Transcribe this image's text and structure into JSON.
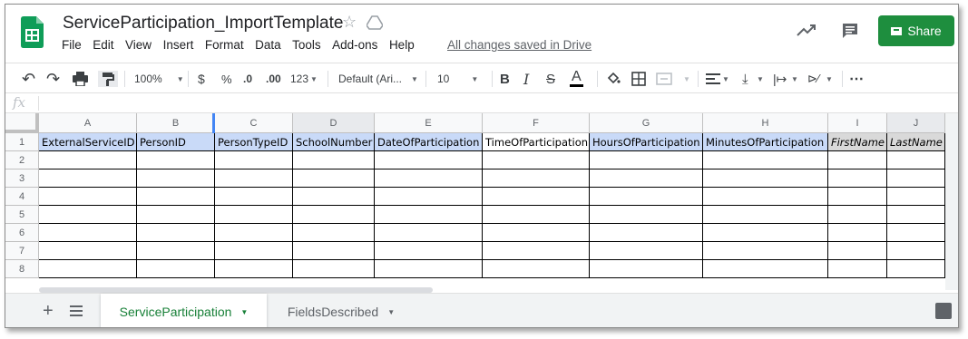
{
  "doc": {
    "title": "ServiceParticipation_ImportTemplate",
    "saved_status": "All changes saved in Drive"
  },
  "menu": [
    "File",
    "Edit",
    "View",
    "Insert",
    "Format",
    "Data",
    "Tools",
    "Add-ons",
    "Help"
  ],
  "share_label": "Share",
  "toolbar": {
    "zoom": "100%",
    "currency": "$",
    "percent": "%",
    "decrease_decimal": ".0",
    "increase_decimal": ".00",
    "more_formats": "123",
    "font": "Default (Ari...",
    "font_size": "10",
    "bold": "B",
    "italic": "I",
    "strike": "S",
    "text_color": "A",
    "more": "⋯"
  },
  "formula_bar": {
    "fx": "fx",
    "value": ""
  },
  "columns": [
    "A",
    "B",
    "C",
    "D",
    "E",
    "F",
    "G",
    "H",
    "I",
    "J"
  ],
  "rows": [
    "1",
    "2",
    "3",
    "4",
    "5",
    "6",
    "7",
    "8"
  ],
  "header_row": [
    "ExternalServiceID",
    "PersonID",
    "PersonTypeID",
    "SchoolNumber",
    "DateOfParticipation",
    "TimeOfParticipation",
    "HoursOfParticipation",
    "MinutesOfParticipation",
    "FirstName",
    "LastName"
  ],
  "sheets": {
    "active": "ServiceParticipation",
    "other": "FieldsDescribed"
  },
  "colors": {
    "share_green": "#1e8e3e",
    "header_blue": "#c9daf8",
    "header_gray": "#d9d9d9",
    "active_tab_green": "#188038"
  }
}
